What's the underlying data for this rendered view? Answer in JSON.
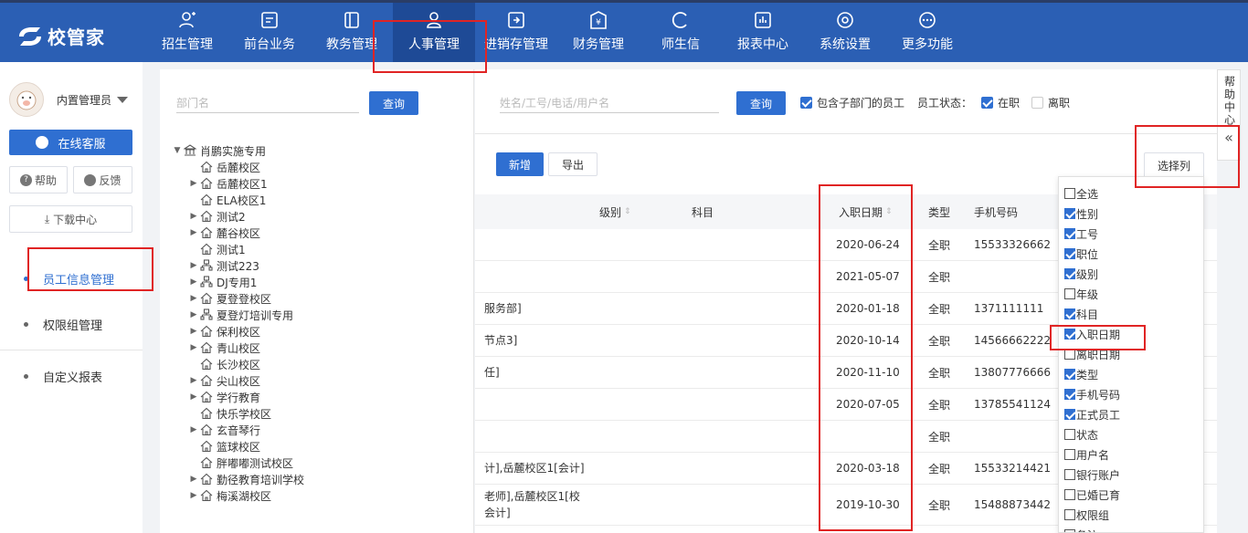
{
  "app": {
    "logo_text": "校管家"
  },
  "nav": [
    {
      "label": "招生管理",
      "icon": "user-plus-icon"
    },
    {
      "label": "前台业务",
      "icon": "monitor-icon"
    },
    {
      "label": "教务管理",
      "icon": "book-icon"
    },
    {
      "label": "人事管理",
      "icon": "person-icon",
      "active": true
    },
    {
      "label": "进销存管理",
      "icon": "inbox-icon"
    },
    {
      "label": "财务管理",
      "icon": "yen-icon"
    },
    {
      "label": "师生信",
      "icon": "chat-icon"
    },
    {
      "label": "报表中心",
      "icon": "chart-icon"
    },
    {
      "label": "系统设置",
      "icon": "gear-icon"
    },
    {
      "label": "更多功能",
      "icon": "more-icon"
    }
  ],
  "sidebar": {
    "user_name": "内置管理员",
    "online_service": "在线客服",
    "help": "帮助",
    "feedback": "反馈",
    "download": "下载中心",
    "menu": [
      {
        "label": "员工信息管理",
        "active": true
      },
      {
        "label": "权限组管理"
      },
      {
        "label": "自定义报表"
      }
    ]
  },
  "tree_panel": {
    "placeholder": "部门名",
    "query": "查询",
    "nodes": [
      {
        "label": "肖鹏实施专用",
        "level": 0,
        "arrow": "down",
        "icon": "bank"
      },
      {
        "label": "岳麓校区",
        "level": 1,
        "arrow": "",
        "icon": "house"
      },
      {
        "label": "岳麓校区1",
        "level": 1,
        "arrow": "right",
        "icon": "house"
      },
      {
        "label": "ELA校区1",
        "level": 1,
        "arrow": "",
        "icon": "house"
      },
      {
        "label": "测试2",
        "level": 1,
        "arrow": "right",
        "icon": "house"
      },
      {
        "label": "麓谷校区",
        "level": 1,
        "arrow": "right",
        "icon": "house"
      },
      {
        "label": "测试1",
        "level": 1,
        "arrow": "",
        "icon": "house"
      },
      {
        "label": "测试223",
        "level": 1,
        "arrow": "right",
        "icon": "org"
      },
      {
        "label": "DJ专用1",
        "level": 1,
        "arrow": "right",
        "icon": "org"
      },
      {
        "label": "夏登登校区",
        "level": 1,
        "arrow": "right",
        "icon": "house"
      },
      {
        "label": "夏登灯培训专用",
        "level": 1,
        "arrow": "right",
        "icon": "org"
      },
      {
        "label": "保利校区",
        "level": 1,
        "arrow": "right",
        "icon": "house"
      },
      {
        "label": "青山校区",
        "level": 1,
        "arrow": "right",
        "icon": "house"
      },
      {
        "label": "长沙校区",
        "level": 1,
        "arrow": "",
        "icon": "house"
      },
      {
        "label": "尖山校区",
        "level": 1,
        "arrow": "right",
        "icon": "house"
      },
      {
        "label": "学行教育",
        "level": 1,
        "arrow": "right",
        "icon": "house"
      },
      {
        "label": "快乐学校区",
        "level": 1,
        "arrow": "",
        "icon": "house"
      },
      {
        "label": "玄音琴行",
        "level": 1,
        "arrow": "right",
        "icon": "house"
      },
      {
        "label": "篮球校区",
        "level": 1,
        "arrow": "",
        "icon": "house"
      },
      {
        "label": "胖嘟嘟测试校区",
        "level": 1,
        "arrow": "",
        "icon": "house"
      },
      {
        "label": "勤径教育培训学校",
        "level": 1,
        "arrow": "right",
        "icon": "house"
      },
      {
        "label": "梅溪湖校区",
        "level": 1,
        "arrow": "right",
        "icon": "house"
      }
    ]
  },
  "filters": {
    "placeholder": "姓名/工号/电话/用户名",
    "query": "查询",
    "include_sub": "包含子部门的员工",
    "status_label": "员工状态：",
    "active": "在职",
    "left": "离职"
  },
  "toolbar": {
    "add": "新增",
    "export": "导出",
    "select_cols": "选择列"
  },
  "table": {
    "headers": {
      "level": "级别",
      "subject": "科目",
      "join_date": "入职日期",
      "type": "类型",
      "phone": "手机号码"
    },
    "rows": [
      {
        "post": "",
        "join_date": "2020-06-24",
        "type": "全职",
        "phone": "15533326662"
      },
      {
        "post": "",
        "join_date": "2021-05-07",
        "type": "全职",
        "phone": ""
      },
      {
        "post": "服务部]",
        "join_date": "2020-01-18",
        "type": "全职",
        "phone": "1371111111"
      },
      {
        "post": "节点3]",
        "join_date": "2020-10-14",
        "type": "全职",
        "phone": "14566662222"
      },
      {
        "post": "任]",
        "join_date": "2020-11-10",
        "type": "全职",
        "phone": "13807776666"
      },
      {
        "post": "",
        "join_date": "2020-07-05",
        "type": "全职",
        "phone": "13785541124"
      },
      {
        "post": "",
        "join_date": "",
        "type": "全职",
        "phone": ""
      },
      {
        "post": "计],岳麓校区1[会计]",
        "join_date": "2020-03-18",
        "type": "全职",
        "phone": "15533214421"
      },
      {
        "post": "老师],岳麓校区1[校",
        "post2": "会计]",
        "join_date": "2019-10-30",
        "type": "全职",
        "phone": "15488873442"
      }
    ]
  },
  "column_picker": [
    {
      "label": "全选",
      "checked": false
    },
    {
      "label": "性别",
      "checked": true
    },
    {
      "label": "工号",
      "checked": true
    },
    {
      "label": "职位",
      "checked": true
    },
    {
      "label": "级别",
      "checked": true
    },
    {
      "label": "年级",
      "checked": false
    },
    {
      "label": "科目",
      "checked": true
    },
    {
      "label": "入职日期",
      "checked": true
    },
    {
      "label": "离职日期",
      "checked": false
    },
    {
      "label": "类型",
      "checked": true
    },
    {
      "label": "手机号码",
      "checked": true
    },
    {
      "label": "正式员工",
      "checked": true
    },
    {
      "label": "状态",
      "checked": false
    },
    {
      "label": "用户名",
      "checked": false
    },
    {
      "label": "银行账户",
      "checked": false
    },
    {
      "label": "已婚已育",
      "checked": false
    },
    {
      "label": "权限组",
      "checked": false
    },
    {
      "label": "备注",
      "checked": false
    }
  ],
  "help_panel": {
    "label": "帮助中心",
    "collapse": "«"
  },
  "colors": {
    "topbar": "#2b5fb4",
    "accent": "#2f6fd1",
    "highlight": "#e02424"
  }
}
